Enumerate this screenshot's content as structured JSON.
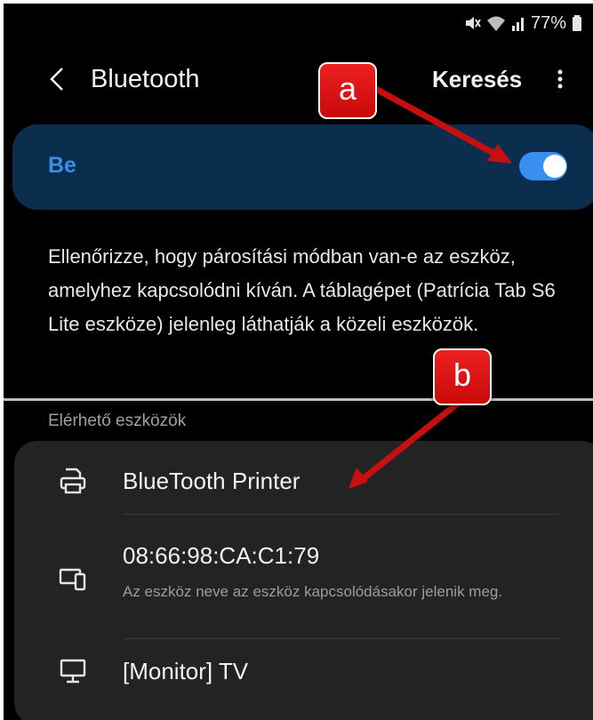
{
  "status_bar": {
    "battery": "77%",
    "mute_icon": "mute-icon",
    "wifi_icon": "wifi-icon",
    "signal_icon": "signal-icon",
    "battery_icon": "battery-icon"
  },
  "header": {
    "title": "Bluetooth",
    "search_label": "Keresés",
    "back_icon": "chevron-left-icon",
    "more_icon": "more-vertical-icon"
  },
  "toggle": {
    "label": "Be",
    "state": "on",
    "accent": "#3a8ef0"
  },
  "description": "Ellenőrizze, hogy párosítási módban van-e az eszköz, amelyhez kapcsolódni kíván. A táblagépet (Patrícia Tab S6 Lite eszköze) jelenleg láthatják a közeli eszközök.",
  "available": {
    "section_label": "Elérhető eszközök",
    "devices": [
      {
        "name": "BlueTooth Printer",
        "icon": "printer-icon"
      },
      {
        "name": "08:66:98:CA:C1:79",
        "subtitle": "Az eszköz neve az eszköz kapcsolódásakor jelenik meg.",
        "icon": "devices-icon"
      },
      {
        "name": "[Monitor] TV",
        "icon": "monitor-icon"
      }
    ]
  },
  "annotations": {
    "a": "a",
    "b": "b",
    "color": "#e01414"
  }
}
